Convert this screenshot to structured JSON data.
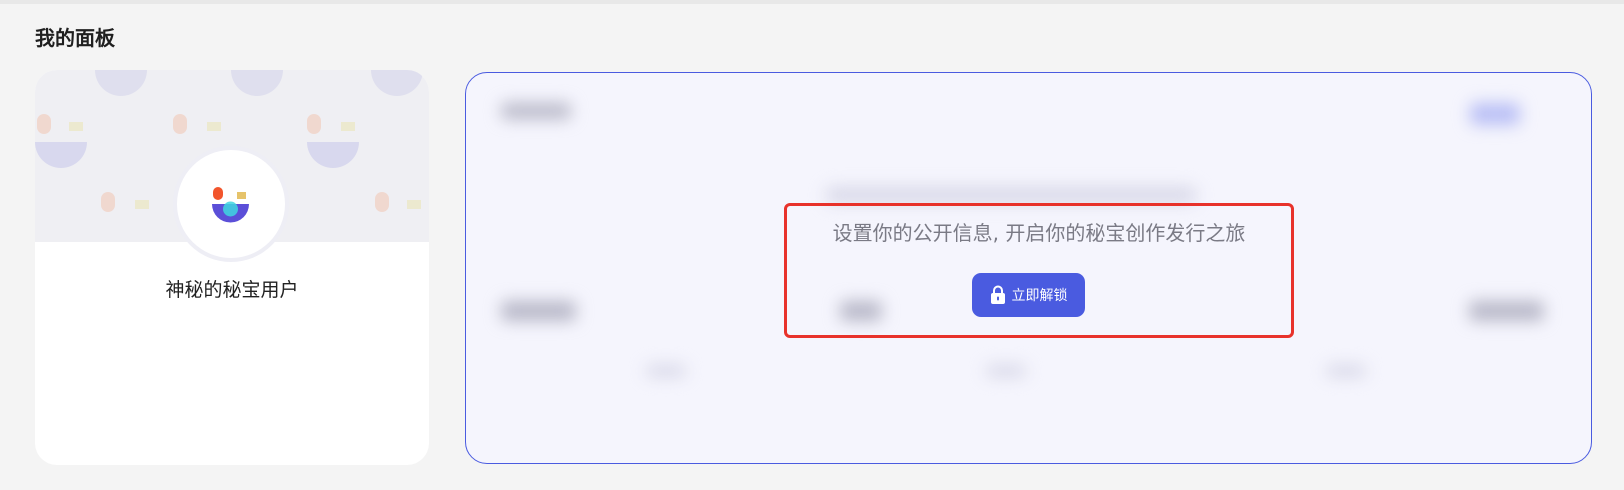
{
  "section": {
    "title": "我的面板"
  },
  "profile": {
    "username": "神秘的秘宝用户",
    "avatar_icon": "smile-face-icon"
  },
  "locked_panel": {
    "message": "设置你的公开信息, 开启你的秘宝创作发行之旅",
    "unlock_button_label": "立即解锁",
    "unlock_icon": "lock-icon"
  },
  "colors": {
    "accent": "#4a5be0",
    "highlight_border": "#e8322b",
    "panel_background": "#f5f5fd",
    "page_background": "#f4f4f4"
  }
}
